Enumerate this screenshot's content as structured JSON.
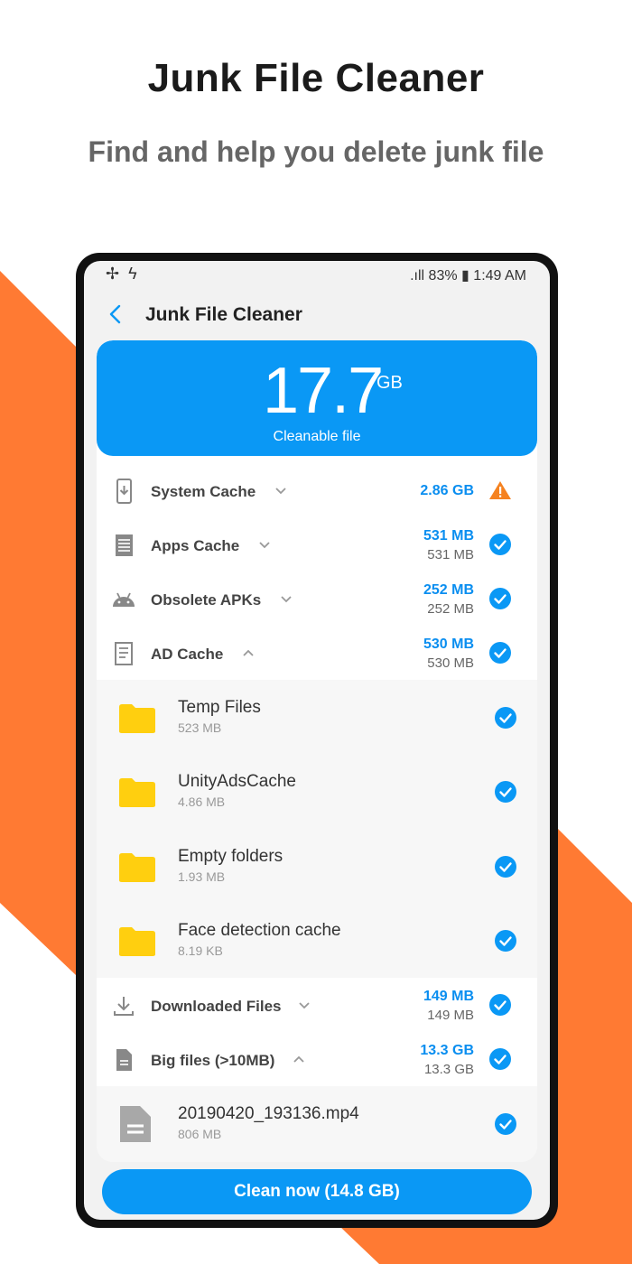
{
  "promo": {
    "headline": "Junk File Cleaner",
    "subline": "Find and help you delete junk file"
  },
  "status": {
    "left_icons": [
      "fan-icon",
      "bolt-icon"
    ],
    "signal": ".ıll",
    "battery": "83%",
    "time": "1:49 AM"
  },
  "appbar": {
    "title": "Junk File Cleaner"
  },
  "summary": {
    "value": "17.7",
    "unit": "GB",
    "label": "Cleanable file"
  },
  "categories": [
    {
      "icon": "phone-download-icon",
      "label": "System Cache",
      "size": "2.86 GB",
      "size_sub": "",
      "status": "warning",
      "expanded": false
    },
    {
      "icon": "receipt-icon",
      "label": "Apps Cache",
      "size": "531 MB",
      "size_sub": "531 MB",
      "status": "checked",
      "expanded": false
    },
    {
      "icon": "android-icon",
      "label": "Obsolete APKs",
      "size": "252 MB",
      "size_sub": "252 MB",
      "status": "checked",
      "expanded": false
    },
    {
      "icon": "ad-doc-icon",
      "label": "AD Cache",
      "size": "530 MB",
      "size_sub": "530 MB",
      "status": "checked",
      "expanded": true
    },
    {
      "icon": "download-icon",
      "label": "Downloaded Files",
      "size": "149 MB",
      "size_sub": "149 MB",
      "status": "checked",
      "expanded": false
    },
    {
      "icon": "file-icon",
      "label": "Big files (>10MB)",
      "size": "13.3 GB",
      "size_sub": "13.3 GB",
      "status": "checked",
      "expanded": true
    }
  ],
  "ad_cache_items": [
    {
      "name": "Temp Files",
      "size": "523 MB"
    },
    {
      "name": "UnityAdsCache",
      "size": "4.86 MB"
    },
    {
      "name": "Empty folders",
      "size": "1.93 MB"
    },
    {
      "name": "Face detection cache",
      "size": "8.19 KB"
    }
  ],
  "big_file_items": [
    {
      "name": "20190420_193136.mp4",
      "size": "806 MB"
    }
  ],
  "action": {
    "label": "Clean now (14.8 GB)"
  },
  "colors": {
    "accent": "#0a98f5",
    "orange": "#ff7a33",
    "warning": "#f58220",
    "folder": "#ffcf0f"
  }
}
